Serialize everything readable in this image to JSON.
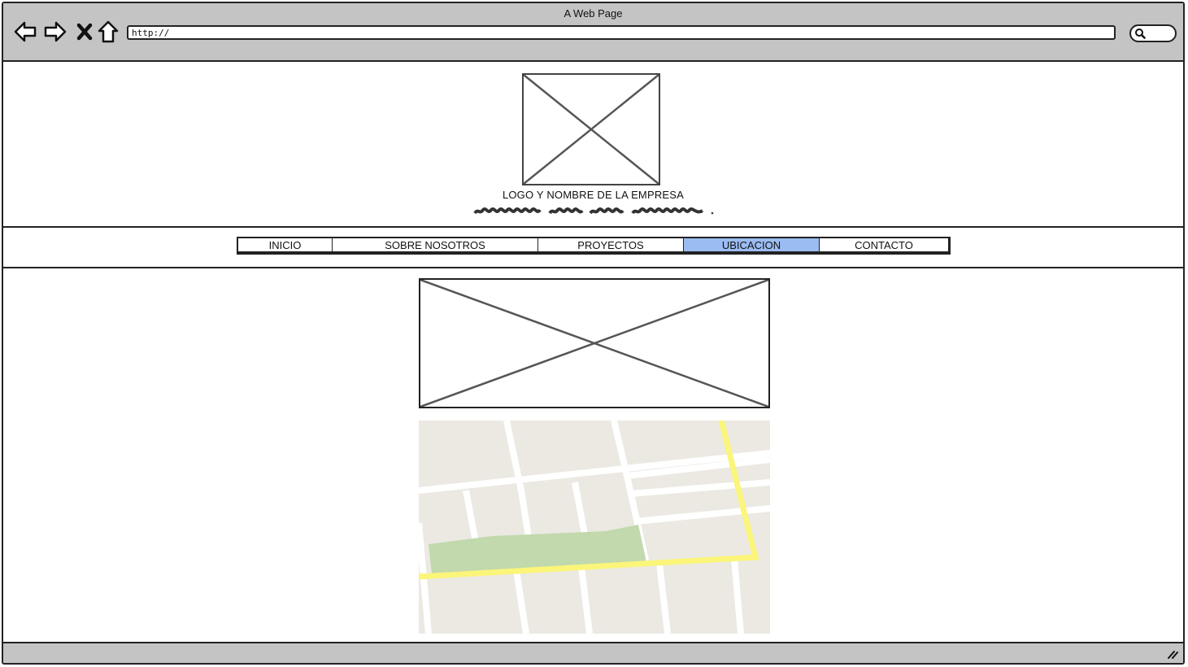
{
  "window": {
    "title": "A Web Page"
  },
  "browser": {
    "url": "http://",
    "buttons": [
      "back",
      "forward",
      "stop",
      "home"
    ]
  },
  "header": {
    "logo_caption": "LOGO Y NOMBRE DE LA EMPRESA"
  },
  "nav": {
    "tabs": [
      {
        "label": "INICIO"
      },
      {
        "label": "SOBRE NOSOTROS"
      },
      {
        "label": "PROYECTOS"
      },
      {
        "label": "UBICACION",
        "active": true
      },
      {
        "label": "CONTACTO"
      }
    ]
  },
  "colors": {
    "chrome": "#c4c4c4",
    "active_tab": "#9bbcf2",
    "map_land": "#ebe9e2",
    "map_park": "#c1d9ad",
    "map_road_highlight": "#fbf57a"
  },
  "icons": [
    "back-arrow-icon",
    "forward-arrow-icon",
    "close-icon",
    "home-icon",
    "search-icon",
    "resize-grip-icon"
  ]
}
